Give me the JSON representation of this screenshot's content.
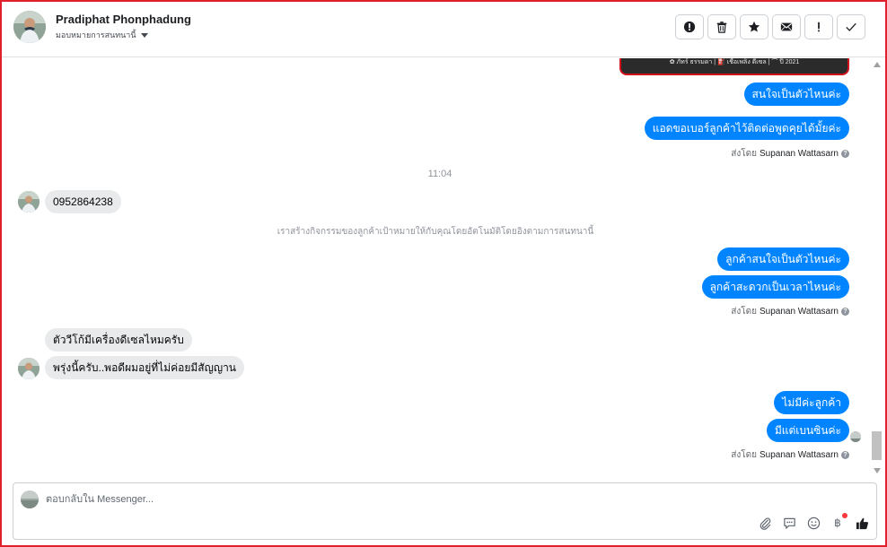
{
  "header": {
    "name": "Pradiphat Phonphadung",
    "assign_label": "มอบหมายการสนทนานี้",
    "actions": [
      "report",
      "delete",
      "star",
      "mark-unread",
      "spam",
      "done"
    ]
  },
  "card_caption": "✿ ภัทร์ ธรรมดา  |  ⛽ เชื้อเพลิง ดีเซล  |  ⌒ ปี 2021",
  "messages": {
    "m1": "สนใจเป็นตัวไหนค่ะ",
    "m2": "แอดขอเบอร์ลูกค้าไว้ติดต่อพูดคุยได้มั้ยค่ะ",
    "sent_by_prefix": "ส่งโดย",
    "agent": "Supanan Wattasarn",
    "time1": "11:04",
    "c1": "0952864238",
    "system_note": "เราสร้างกิจกรรมของลูกค้าเป้าหมายให้กับคุณโดยอัตโนมัติโดยอิงตามการสนทนานี้",
    "m3": "ลูกค้าสนใจเป็นตัวไหนค่ะ",
    "m4": "ลูกค้าสะดวกเป็นเวลาไหนค่ะ",
    "c2": "ตัววีโก้มีเครื่องดีเซลไหมครับ",
    "c3": "พรุ่งนี้ครับ..พอดีผมอยู่ที่ไม่ค่อยมีสัญญาน",
    "m5": "ไม่มีค่ะลูกค้า",
    "m6": "มีแต่เบนซินค่ะ"
  },
  "composer": {
    "placeholder": "ตอบกลับใน Messenger..."
  },
  "colors": {
    "outgoing_bubble": "#0084ff",
    "incoming_bubble": "#e9eaeb",
    "frame": "#e0202a"
  },
  "icons": [
    "attach-icon",
    "saved-reply-icon",
    "emoji-icon",
    "baht-payment-icon",
    "like-icon"
  ]
}
